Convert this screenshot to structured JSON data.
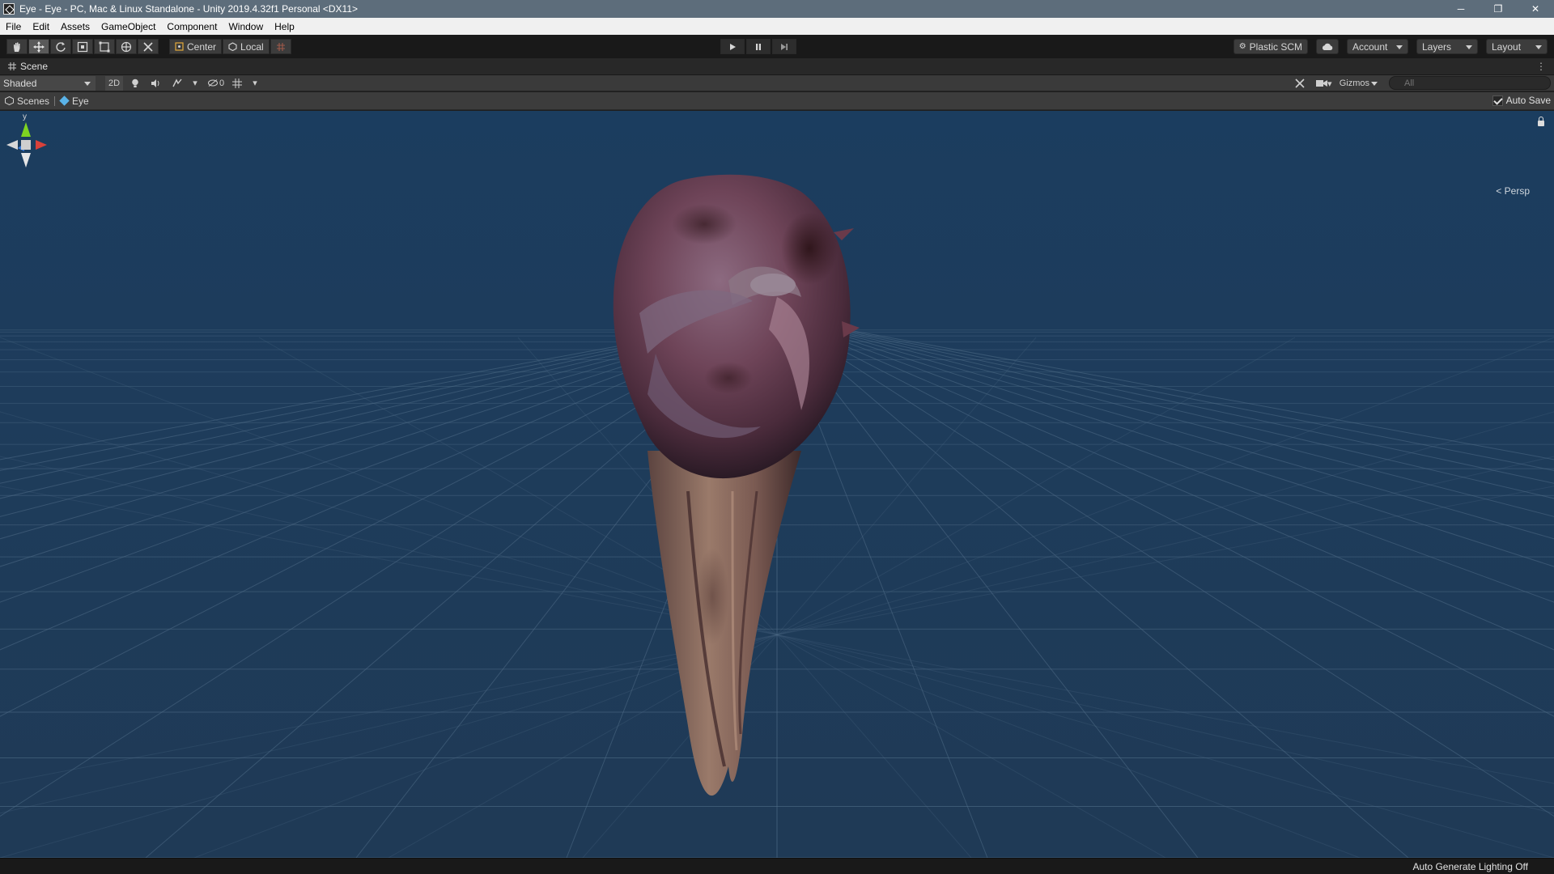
{
  "window": {
    "title": "Eye - Eye - PC, Mac & Linux Standalone - Unity 2019.4.32f1 Personal <DX11>",
    "controls": {
      "minimize": "─",
      "restore": "❐",
      "close": "✕"
    }
  },
  "menu": [
    "File",
    "Edit",
    "Assets",
    "GameObject",
    "Component",
    "Window",
    "Help"
  ],
  "toolbar": {
    "tools": [
      "hand-tool",
      "move-tool",
      "rotate-tool",
      "scale-tool",
      "rect-tool",
      "transform-tool",
      "custom-tool"
    ],
    "active_tool": "move-tool",
    "pivot_label": "Center",
    "space_label": "Local",
    "plastic_label": "Plastic SCM",
    "account_label": "Account",
    "layers_label": "Layers",
    "layout_label": "Layout"
  },
  "scene_tab": {
    "label": "Scene"
  },
  "scene_toolbar": {
    "draw_mode": "Shaded",
    "mode_2d": "2D",
    "hidden_count": "0",
    "gizmos_label": "Gizmos",
    "search_placeholder": "All"
  },
  "breadcrumb": {
    "scenes_label": "Scenes",
    "current": "Eye",
    "autosave_label": "Auto Save",
    "autosave_checked": true
  },
  "viewport": {
    "projection_label": "Persp",
    "axis_label_y": "y"
  },
  "status": {
    "message": "Auto Generate Lighting Off"
  },
  "colors": {
    "accent_sky": "#1e3c5b",
    "grid_line": "#4f6c87",
    "axis_x": "#d9413a",
    "axis_y": "#7ed321",
    "axis_z": "#3b7bd9"
  }
}
